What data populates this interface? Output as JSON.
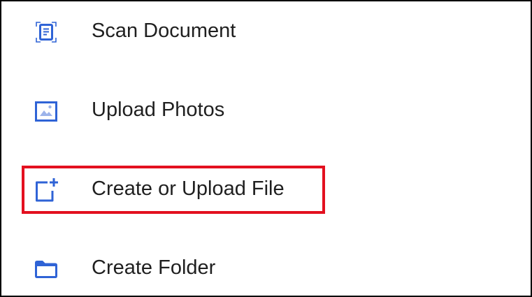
{
  "menu": {
    "items": [
      {
        "label": "Scan Document",
        "icon": "scan-document-icon"
      },
      {
        "label": "Upload Photos",
        "icon": "upload-photos-icon"
      },
      {
        "label": "Create or Upload File",
        "icon": "create-file-icon",
        "highlighted": true
      },
      {
        "label": "Create Folder",
        "icon": "folder-icon"
      }
    ]
  },
  "colors": {
    "icon": "#2f63d6",
    "highlight": "#e3101f",
    "text": "#1f1f1f"
  }
}
